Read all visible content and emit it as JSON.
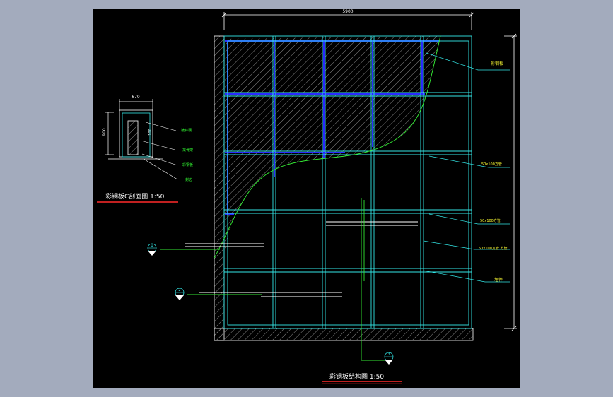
{
  "colors": {
    "background": "#a3abbd",
    "viewport": "#000000",
    "frame": "#33e6e6",
    "grid_blue": "#2a2aff",
    "curve": "#33e633",
    "text_white": "#ffffff",
    "text_yellow": "#ffff33",
    "text_green": "#33ff33",
    "title_underline": "#ff2a2a",
    "hatch": "#9a9a9a"
  },
  "main_drawing": {
    "dim_width": "5900",
    "dim_height": "6900",
    "title": "彩钢板结构图 1:50",
    "labels": {
      "caigangban": "彩钢板",
      "fangguan_1": "50x100方管",
      "fangguan_2": "50x100方管",
      "fangguan_3": "50x100方管 方管",
      "maojian": "埋件"
    }
  },
  "section_detail": {
    "dim_width": "670",
    "dim_height": "900",
    "dim_inner": "100",
    "title": "彩钢板C剖面图 1:50",
    "labels": {
      "label_1": "镀锌钢",
      "label_2": "龙骨架",
      "label_3": "彩钢板",
      "label_4": "封边"
    }
  },
  "markers": {
    "marker_1": "1",
    "marker_2": "2",
    "marker_3": "3"
  }
}
